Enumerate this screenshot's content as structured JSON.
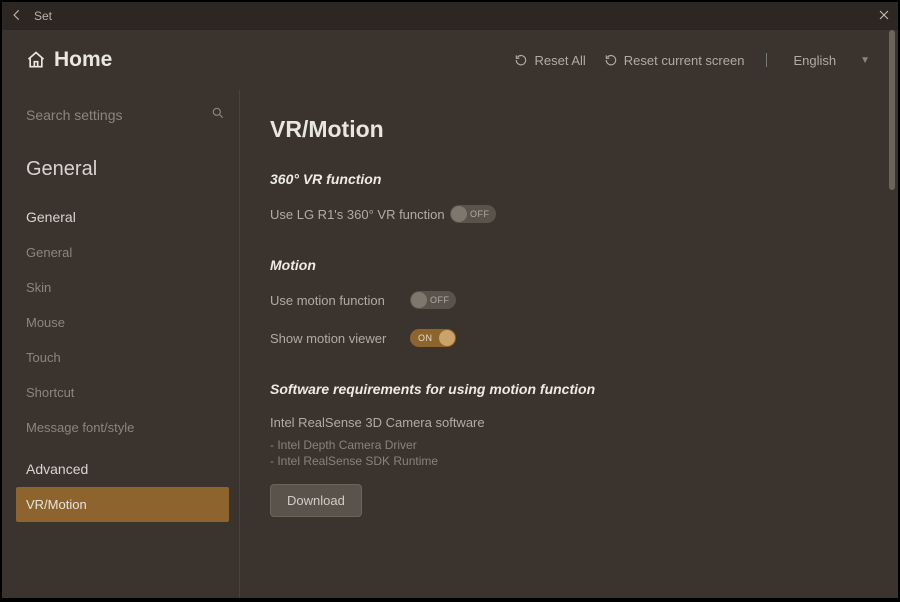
{
  "titlebar": {
    "title": "Set"
  },
  "topbar": {
    "home_label": "Home",
    "reset_all": "Reset All",
    "reset_screen": "Reset current screen",
    "language": "English"
  },
  "search": {
    "placeholder": "Search settings"
  },
  "sidebar": {
    "section": "General",
    "group1": "General",
    "items1": {
      "general": "General",
      "skin": "Skin",
      "mouse": "Mouse",
      "touch": "Touch",
      "shortcut": "Shortcut",
      "message": "Message font/style"
    },
    "group2": "Advanced",
    "items2": {
      "vrmotion": "VR/Motion"
    }
  },
  "content": {
    "title": "VR/Motion",
    "sec_vr": "360° VR function",
    "vr_label": "Use LG R1's 360° VR function",
    "vr_state": "OFF",
    "sec_motion": "Motion",
    "motion_use_label": "Use motion function",
    "motion_use_state": "OFF",
    "motion_show_label": "Show motion viewer",
    "motion_show_state": "ON",
    "sec_req": "Software requirements for using motion function",
    "req_main": "Intel RealSense 3D Camera software",
    "req_sub1": "- Intel Depth Camera Driver",
    "req_sub2": "- Intel RealSense SDK Runtime",
    "download": "Download"
  }
}
